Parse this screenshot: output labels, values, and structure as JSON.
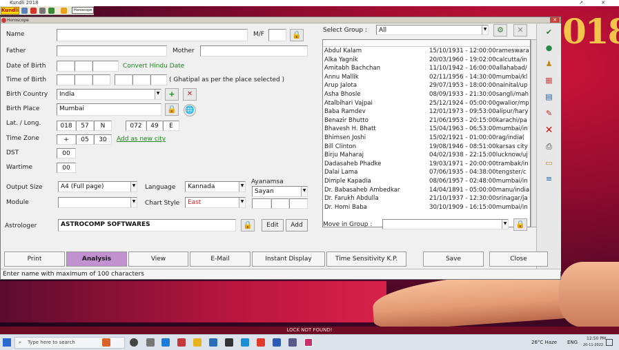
{
  "app": {
    "window_title": "Kundli 2018",
    "logo_text": "Kundli",
    "toolbar_box": "Horoscope"
  },
  "wallpaper": {
    "year": "018",
    "lock_text": "LOCK NOT FOUND!"
  },
  "dialog": {
    "title": "Horoscope",
    "close_glyph": "✕"
  },
  "form": {
    "name_label": "Name",
    "name_value": "",
    "mf_label": "M/F",
    "mf_value": "",
    "father_label": "Father",
    "father_value": "",
    "mother_label": "Mother",
    "mother_value": "",
    "dob_label": "Date of Birth",
    "convert_hindu_date": "Convert Hindu Date",
    "tob_label": "Time of Birth",
    "ghatipal_note": "( Ghatipal as per the place selected )",
    "country_label": "Birth Country",
    "country_value": "India",
    "place_label": "Birth Place",
    "place_value": "Mumbai",
    "latlong_label": "Lat. / Long.",
    "lat_deg": "018",
    "lat_min": "57",
    "lat_dir": "N",
    "long_deg": "072",
    "long_min": "49",
    "long_dir": "E",
    "tz_label": "Time Zone",
    "tz_sign": "+",
    "tz_hours": "05",
    "tz_minutes": "30",
    "add_city": "Add as new city",
    "dst_label": "DST",
    "dst_value": "00",
    "wartime_label": "Wartime",
    "wartime_value": "00",
    "output_label": "Output Size",
    "output_value": "A4 (Full page)",
    "language_label": "Language",
    "language_value": "Kannada",
    "ayanamsa_label": "Ayanamsa",
    "ayanamsa_value": "Sayan",
    "module_label": "Module",
    "module_value": "",
    "chartstyle_label": "Chart Style",
    "chartstyle_value": "East",
    "astrologer_label": "Astrologer",
    "astrologer_value": "ASTROCOMP  SOFTWARES",
    "edit_label": "Edit",
    "add_label": "Add"
  },
  "group": {
    "select_label": "Select Group :",
    "select_value": "All",
    "move_label": "Move in Group :",
    "move_value": ""
  },
  "records": [
    {
      "name": "Abdul Kalam",
      "date": "15/10/1931 - 12:00:00",
      "place": "rameswara"
    },
    {
      "name": "Alka Yagnik",
      "date": "20/03/1960 - 19:02:00",
      "place": "calcutta/in"
    },
    {
      "name": "Amitabh Bachchan",
      "date": "11/10/1942 - 16:00:00",
      "place": "allahabad/"
    },
    {
      "name": "Annu Mallik",
      "date": "02/11/1956 - 14:30:00",
      "place": "mumbai/kl"
    },
    {
      "name": "Arup Jalota",
      "date": "29/07/1953 - 18:00:00",
      "place": "nainital/up"
    },
    {
      "name": "Asha Bhosle",
      "date": "08/09/1933 - 21:30:00",
      "place": "sangli/mah"
    },
    {
      "name": "Atalbihari Vajpai",
      "date": "25/12/1924 - 05:00:00",
      "place": "gwalior/mp"
    },
    {
      "name": "Baba Ramdev",
      "date": "12/01/1973 - 09:53:00",
      "place": "alipur/hary"
    },
    {
      "name": "Benazir Bhutto",
      "date": "21/06/1953 - 20:15:00",
      "place": "karachi/pa"
    },
    {
      "name": "Bhavesh H. Bhatt",
      "date": "15/04/1963 - 06:53:00",
      "place": "mumbai/in"
    },
    {
      "name": "Bhimsen Joshi",
      "date": "15/02/1921 - 01:00:00",
      "place": "rag/india("
    },
    {
      "name": "Bill Clinton",
      "date": "19/08/1946 - 08:51:00",
      "place": "karsas city"
    },
    {
      "name": "Birju Maharaj",
      "date": "04/02/1938 - 22:15:00",
      "place": "lucknow/uj"
    },
    {
      "name": "Dadasaheb Phadke",
      "date": "19/03/1971 - 20:00:00",
      "place": "trambak/in"
    },
    {
      "name": "Dalai Lama",
      "date": "07/06/1935 - 04:38:00",
      "place": "tengster/c"
    },
    {
      "name": "Dimple Kapadia",
      "date": "08/06/1957 - 02:48:00",
      "place": "mumbai/in"
    },
    {
      "name": "Dr. Babasaheb Ambedkar",
      "date": "14/04/1891 - 05:00:00",
      "place": "manu/india"
    },
    {
      "name": "Dr. Farukh Abdulla",
      "date": "21/10/1937 - 12:30:00",
      "place": "srinagar/ja"
    },
    {
      "name": "Dr. Homi Baba",
      "date": "30/10/1909 - 16:15:00",
      "place": "mumbai/in"
    }
  ],
  "bottom_buttons": {
    "print": "Print",
    "analysis": "Analysis",
    "view": "View",
    "email": "E-Mail",
    "instant": "Instant Display",
    "time_sens": "Time Sensitivity K.P.",
    "save": "Save",
    "close": "Close"
  },
  "status": "Enter name with maximum of 100 characters",
  "taskbar": {
    "search_placeholder": "Type here to search",
    "weather": "26°C Haze",
    "time": "12:50 PM",
    "date": "20-11-2022",
    "lang": "ENG"
  },
  "colors": {
    "accent_tab": "#c291cf",
    "link_green": "#1a8a1a",
    "chart_style_red": "#d01818"
  }
}
